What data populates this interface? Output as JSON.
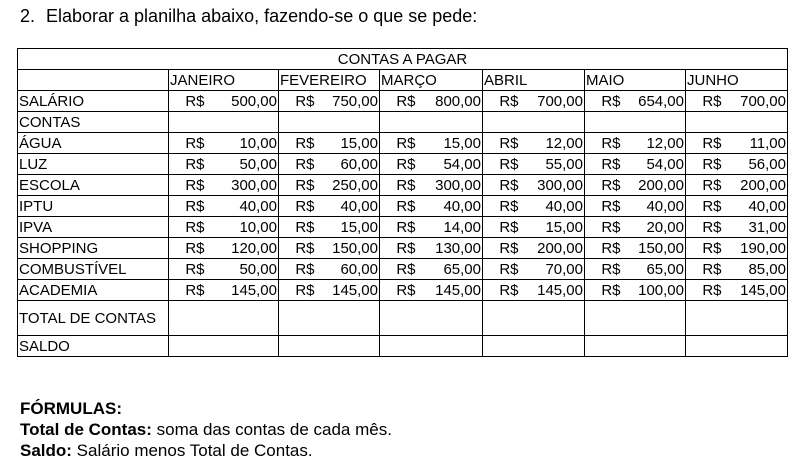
{
  "heading": {
    "number": "2.",
    "text": "Elaborar a planilha abaixo, fazendo-se o que se pede:"
  },
  "table": {
    "title": "CONTAS A PAGAR",
    "currency": "R$",
    "months": [
      "JANEIRO",
      "FEVEREIRO",
      "MARÇO",
      "ABRIL",
      "MAIO",
      "JUNHO"
    ],
    "salary": {
      "label": "SALÁRIO",
      "values": [
        "500,00",
        "750,00",
        "800,00",
        "700,00",
        "654,00",
        "700,00"
      ]
    },
    "accounts_label": "CONTAS",
    "rows": [
      {
        "label": "ÁGUA",
        "values": [
          "10,00",
          "15,00",
          "15,00",
          "12,00",
          "12,00",
          "11,00"
        ]
      },
      {
        "label": "LUZ",
        "values": [
          "50,00",
          "60,00",
          "54,00",
          "55,00",
          "54,00",
          "56,00"
        ]
      },
      {
        "label": "ESCOLA",
        "values": [
          "300,00",
          "250,00",
          "300,00",
          "300,00",
          "200,00",
          "200,00"
        ]
      },
      {
        "label": "IPTU",
        "values": [
          "40,00",
          "40,00",
          "40,00",
          "40,00",
          "40,00",
          "40,00"
        ]
      },
      {
        "label": "IPVA",
        "values": [
          "10,00",
          "15,00",
          "14,00",
          "15,00",
          "20,00",
          "31,00"
        ]
      },
      {
        "label": "SHOPPING",
        "values": [
          "120,00",
          "150,00",
          "130,00",
          "200,00",
          "150,00",
          "190,00"
        ]
      },
      {
        "label": "COMBUSTÍVEL",
        "values": [
          "50,00",
          "60,00",
          "65,00",
          "70,00",
          "65,00",
          "85,00"
        ]
      },
      {
        "label": "ACADEMIA",
        "values": [
          "145,00",
          "145,00",
          "145,00",
          "145,00",
          "100,00",
          "145,00"
        ]
      }
    ],
    "total_label": "TOTAL DE CONTAS",
    "balance_label": "SALDO"
  },
  "notes": {
    "heading": "FÓRMULAS:",
    "items": [
      {
        "term": "Total de Contas:",
        "text": " soma das contas de cada mês."
      },
      {
        "term": "Saldo:",
        "text": " Salário menos Total de Contas."
      }
    ]
  }
}
